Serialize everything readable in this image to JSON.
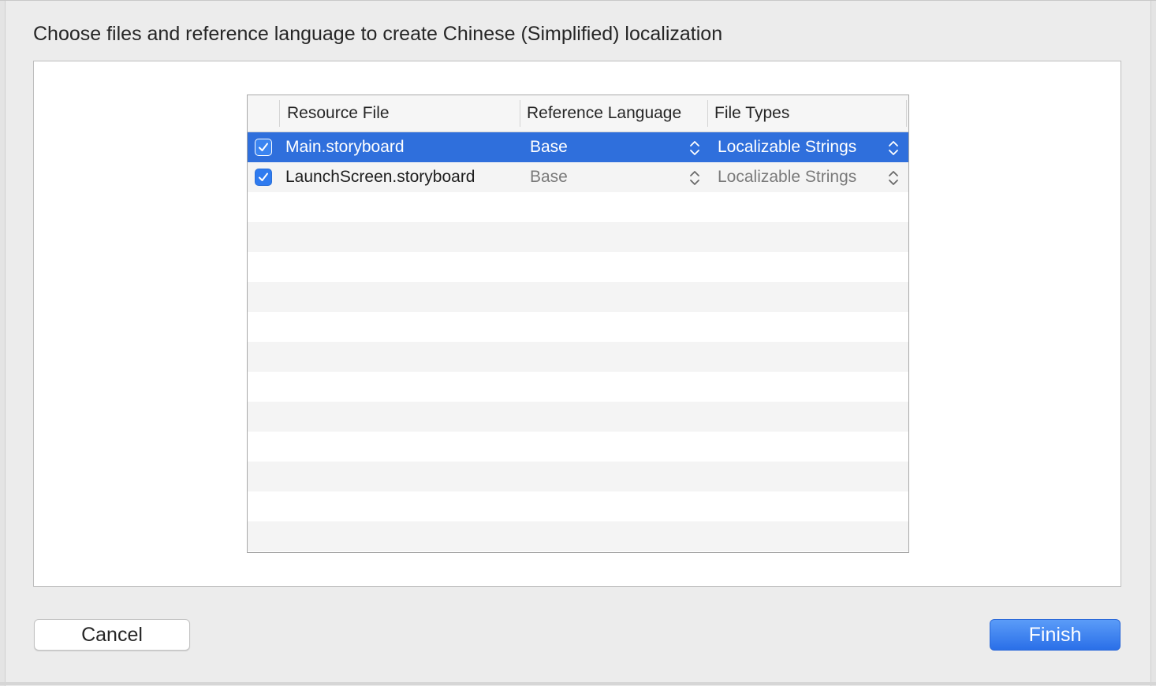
{
  "dialog": {
    "title": "Choose files and reference language to create Chinese (Simplified) localization"
  },
  "table": {
    "columns": [
      "Resource File",
      "Reference Language",
      "File Types"
    ],
    "rows": [
      {
        "checked": true,
        "selected": true,
        "file": "Main.storyboard",
        "reference_language": "Base",
        "file_type": "Localizable Strings"
      },
      {
        "checked": true,
        "selected": false,
        "file": "LaunchScreen.storyboard",
        "reference_language": "Base",
        "file_type": "Localizable Strings"
      }
    ]
  },
  "buttons": {
    "cancel": "Cancel",
    "finish": "Finish"
  },
  "colors": {
    "selection": "#2f6fdc",
    "checkbox": "#2f7bef",
    "default_button": "#2a6fe8"
  }
}
